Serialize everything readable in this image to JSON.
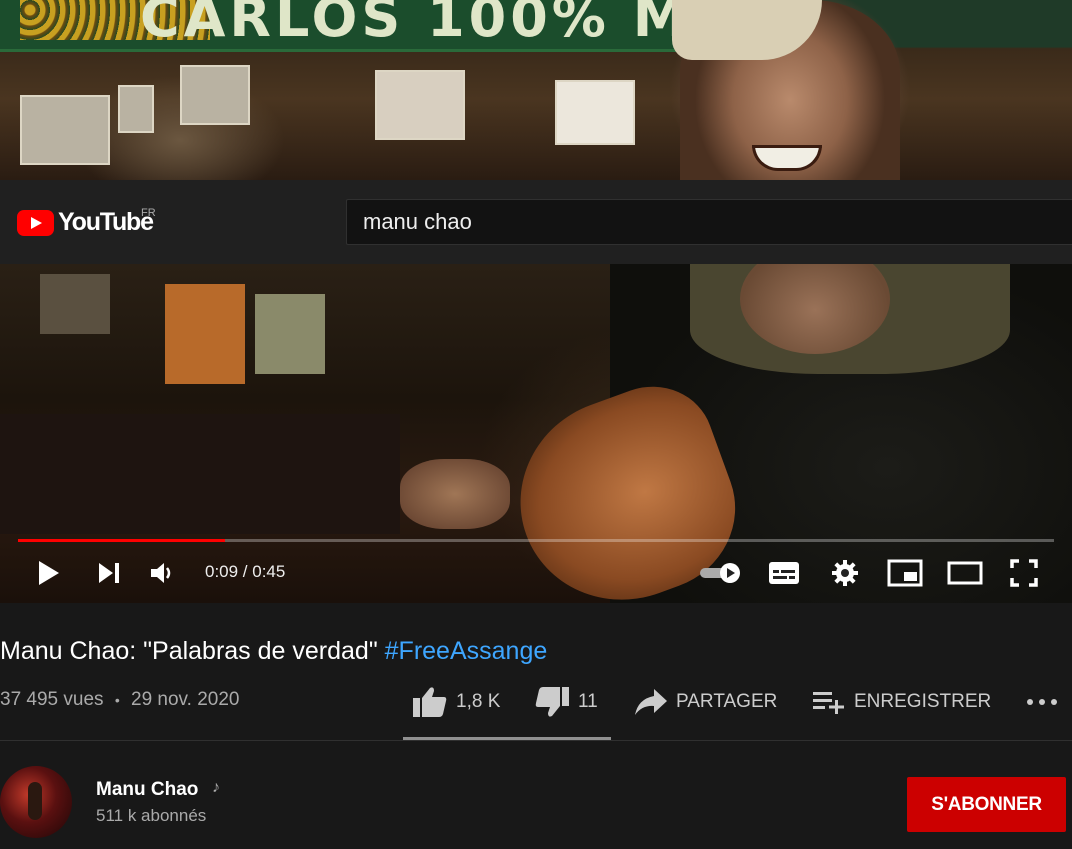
{
  "background": {
    "banner_text": "CARLOS 100% MA"
  },
  "header": {
    "logo_text": "YouTube",
    "country_code": "FR",
    "search_value": "manu chao"
  },
  "player": {
    "progress_fraction": 0.2,
    "time_current": "0:09",
    "time_total": "0:45",
    "time_display": "0:09 / 0:45",
    "controls": [
      "play-icon",
      "next-icon",
      "volume-icon",
      "autoplay-toggle",
      "subtitles-icon",
      "settings-icon",
      "miniplayer-icon",
      "theater-icon",
      "fullscreen-icon"
    ]
  },
  "video": {
    "title": "Manu Chao: \"Palabras de verdad\" ",
    "hashtag": "#FreeAssange",
    "views": "37 495 vues",
    "separator": "•",
    "date": "29 nov. 2020",
    "likes": "1,8 K",
    "dislikes": "11",
    "share_label": "PARTAGER",
    "save_label": "ENREGISTRER",
    "like_ratio": 0.99
  },
  "channel": {
    "name": "Manu Chao",
    "subscribers": "511 k abonnés",
    "subscribe_label": "S'ABONNER"
  },
  "colors": {
    "accent_red": "#ff0000",
    "subscribe_red": "#cc0000",
    "hashtag_blue": "#3ea6ff",
    "background": "#181818"
  }
}
